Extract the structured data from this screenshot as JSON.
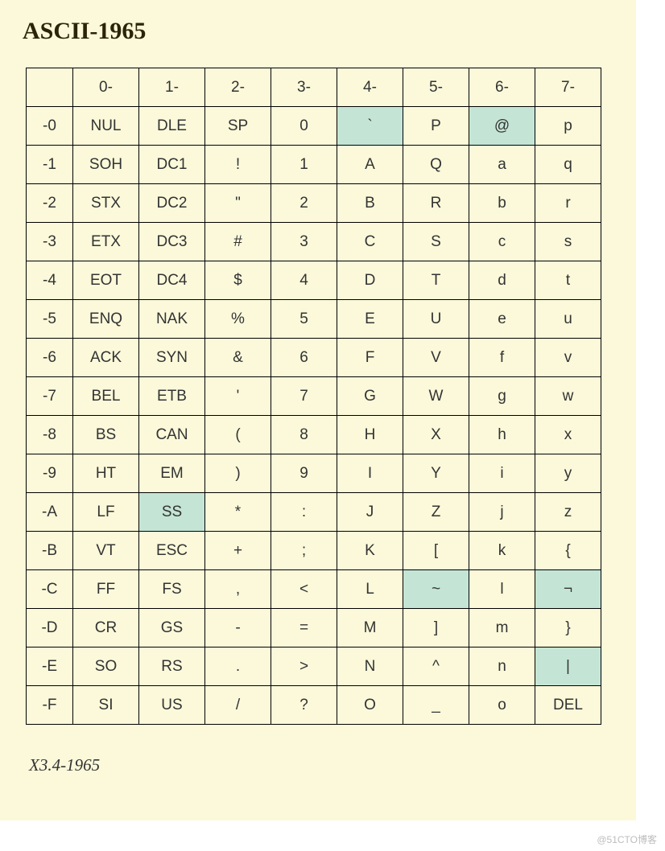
{
  "title": "ASCII-1965",
  "col_headers": [
    "0-",
    "1-",
    "2-",
    "3-",
    "4-",
    "5-",
    "6-",
    "7-"
  ],
  "row_headers": [
    "-0",
    "-1",
    "-2",
    "-3",
    "-4",
    "-5",
    "-6",
    "-7",
    "-8",
    "-9",
    "-A",
    "-B",
    "-C",
    "-D",
    "-E",
    "-F"
  ],
  "cells": [
    [
      "NUL",
      "DLE",
      "SP",
      "0",
      "`",
      "P",
      "@",
      "p"
    ],
    [
      "SOH",
      "DC1",
      "!",
      "1",
      "A",
      "Q",
      "a",
      "q"
    ],
    [
      "STX",
      "DC2",
      "\"",
      "2",
      "B",
      "R",
      "b",
      "r"
    ],
    [
      "ETX",
      "DC3",
      "#",
      "3",
      "C",
      "S",
      "c",
      "s"
    ],
    [
      "EOT",
      "DC4",
      "$",
      "4",
      "D",
      "T",
      "d",
      "t"
    ],
    [
      "ENQ",
      "NAK",
      "%",
      "5",
      "E",
      "U",
      "e",
      "u"
    ],
    [
      "ACK",
      "SYN",
      "&",
      "6",
      "F",
      "V",
      "f",
      "v"
    ],
    [
      "BEL",
      "ETB",
      "'",
      "7",
      "G",
      "W",
      "g",
      "w"
    ],
    [
      "BS",
      "CAN",
      "(",
      "8",
      "H",
      "X",
      "h",
      "x"
    ],
    [
      "HT",
      "EM",
      ")",
      "9",
      "I",
      "Y",
      "i",
      "y"
    ],
    [
      "LF",
      "SS",
      "*",
      ":",
      "J",
      "Z",
      "j",
      "z"
    ],
    [
      "VT",
      "ESC",
      "+",
      ";",
      "K",
      "[",
      "k",
      "{"
    ],
    [
      "FF",
      "FS",
      ",",
      "<",
      "L",
      "~",
      "l",
      "¬"
    ],
    [
      "CR",
      "GS",
      "-",
      "=",
      "M",
      "]",
      "m",
      "}"
    ],
    [
      "SO",
      "RS",
      ".",
      ">",
      "N",
      "^",
      "n",
      "|"
    ],
    [
      "SI",
      "US",
      "/",
      "?",
      "O",
      "_",
      "o",
      "DEL"
    ]
  ],
  "highlights": [
    [
      0,
      4
    ],
    [
      0,
      6
    ],
    [
      10,
      1
    ],
    [
      12,
      5
    ],
    [
      12,
      7
    ],
    [
      14,
      7
    ]
  ],
  "caption": "X3.4-1965",
  "watermark": "@51CTO博客",
  "chart_data": {
    "type": "table",
    "title": "ASCII-1965",
    "columns": [
      "0-",
      "1-",
      "2-",
      "3-",
      "4-",
      "5-",
      "6-",
      "7-"
    ],
    "rows": [
      "-0",
      "-1",
      "-2",
      "-3",
      "-4",
      "-5",
      "-6",
      "-7",
      "-8",
      "-9",
      "-A",
      "-B",
      "-C",
      "-D",
      "-E",
      "-F"
    ],
    "values": [
      [
        "NUL",
        "DLE",
        "SP",
        "0",
        "`",
        "P",
        "@",
        "p"
      ],
      [
        "SOH",
        "DC1",
        "!",
        "1",
        "A",
        "Q",
        "a",
        "q"
      ],
      [
        "STX",
        "DC2",
        "\"",
        "2",
        "B",
        "R",
        "b",
        "r"
      ],
      [
        "ETX",
        "DC3",
        "#",
        "3",
        "C",
        "S",
        "c",
        "s"
      ],
      [
        "EOT",
        "DC4",
        "$",
        "4",
        "D",
        "T",
        "d",
        "t"
      ],
      [
        "ENQ",
        "NAK",
        "%",
        "5",
        "E",
        "U",
        "e",
        "u"
      ],
      [
        "ACK",
        "SYN",
        "&",
        "6",
        "F",
        "V",
        "f",
        "v"
      ],
      [
        "BEL",
        "ETB",
        "'",
        "7",
        "G",
        "W",
        "g",
        "w"
      ],
      [
        "BS",
        "CAN",
        "(",
        "8",
        "H",
        "X",
        "h",
        "x"
      ],
      [
        "HT",
        "EM",
        ")",
        "9",
        "I",
        "Y",
        "i",
        "y"
      ],
      [
        "LF",
        "SS",
        "*",
        ":",
        "J",
        "Z",
        "j",
        "z"
      ],
      [
        "VT",
        "ESC",
        "+",
        ";",
        "K",
        "[",
        "k",
        "{"
      ],
      [
        "FF",
        "FS",
        ",",
        "<",
        "L",
        "~",
        "l",
        "¬"
      ],
      [
        "CR",
        "GS",
        "-",
        "=",
        "M",
        "]",
        "m",
        "}"
      ],
      [
        "SO",
        "RS",
        ".",
        ">",
        "N",
        "^",
        "n",
        "|"
      ],
      [
        "SI",
        "US",
        "/",
        "?",
        "O",
        "_",
        "o",
        "DEL"
      ]
    ],
    "highlighted_cells": [
      [
        0,
        4
      ],
      [
        0,
        6
      ],
      [
        10,
        1
      ],
      [
        12,
        5
      ],
      [
        12,
        7
      ],
      [
        14,
        7
      ]
    ],
    "caption": "X3.4-1965"
  }
}
